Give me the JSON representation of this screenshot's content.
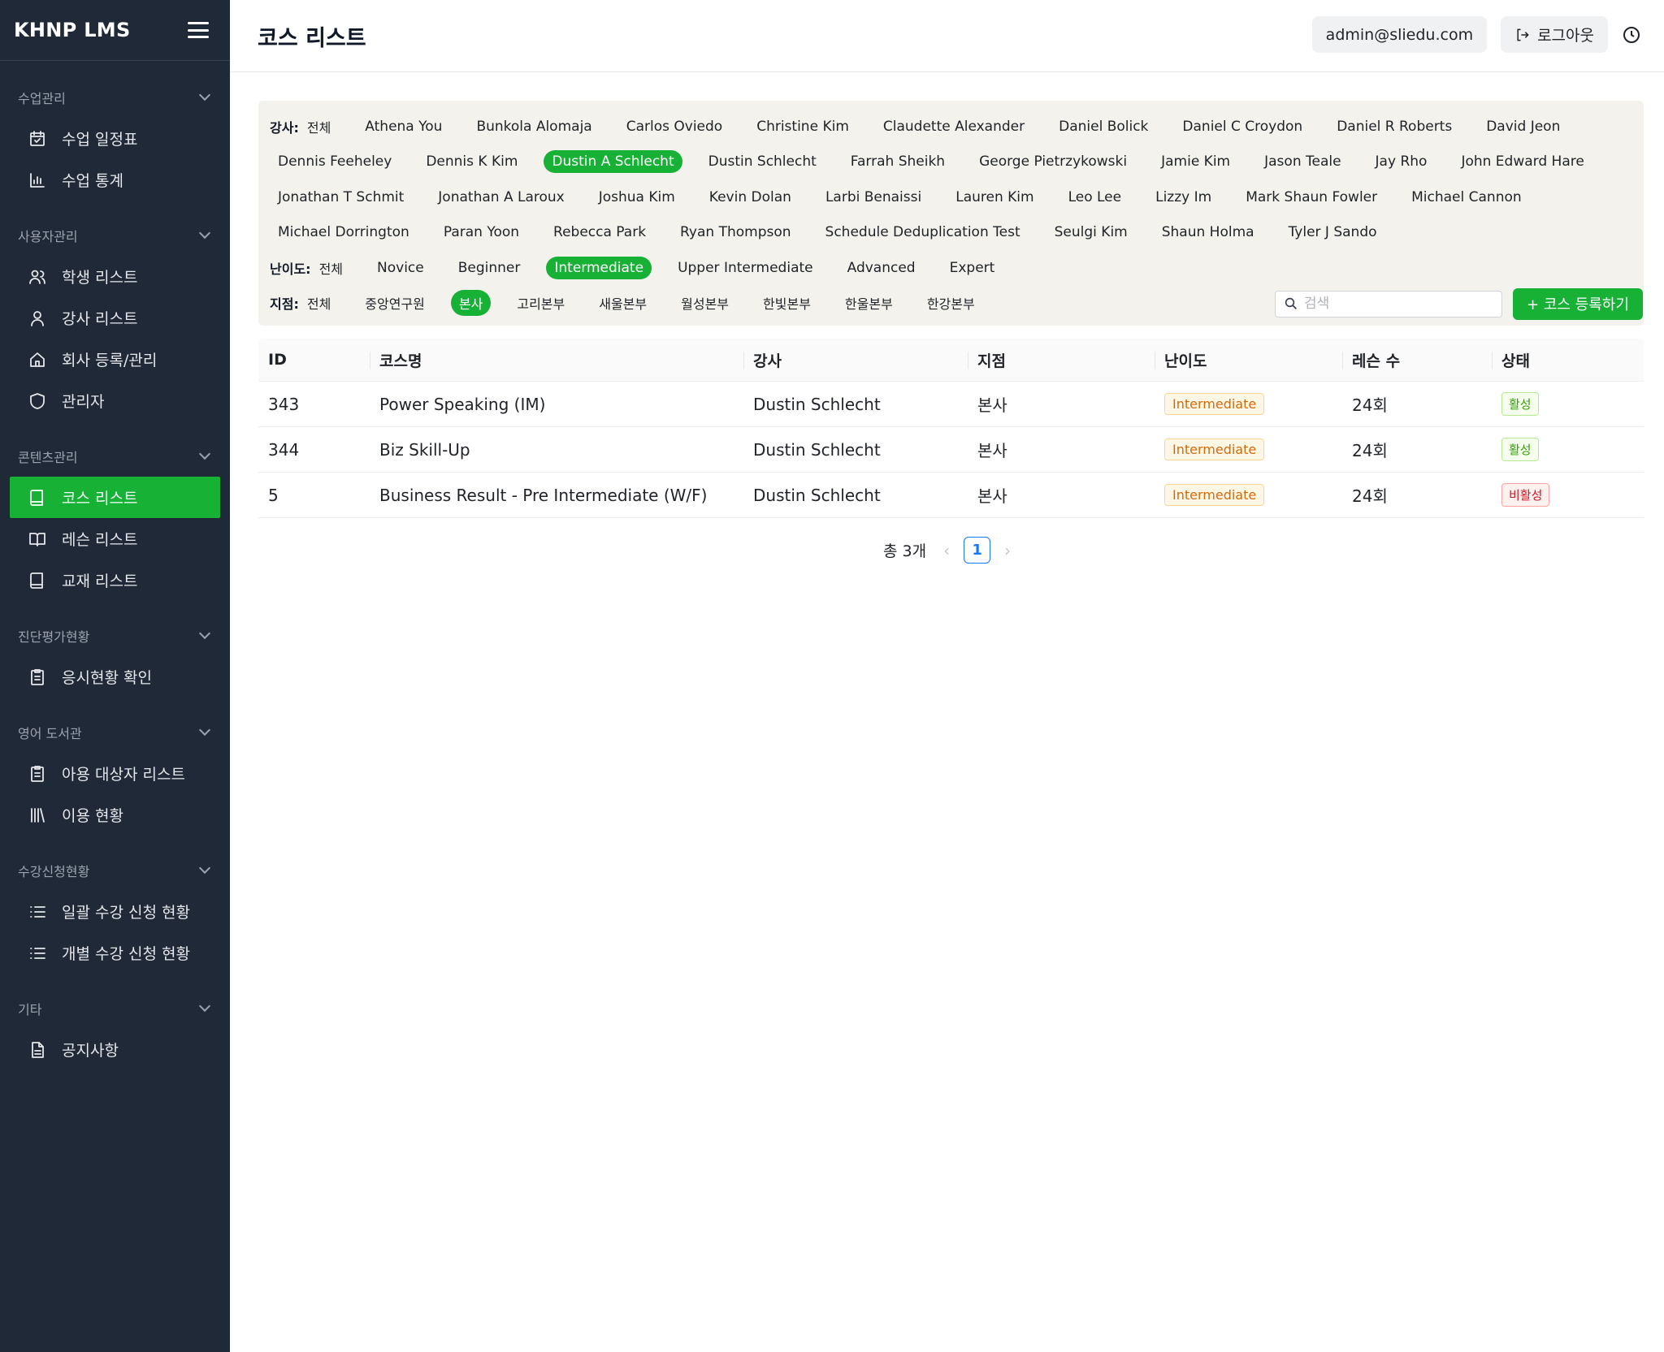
{
  "app": {
    "brand": "KHNP LMS"
  },
  "header": {
    "title": "코스 리스트",
    "email": "admin@sliedu.com",
    "logout_label": "로그아웃"
  },
  "sidebar": {
    "sections": [
      {
        "label": "수업관리",
        "items": [
          {
            "label": "수업 일정표",
            "icon": "calendar-check-icon"
          },
          {
            "label": "수업 통계",
            "icon": "bar-chart-icon"
          }
        ]
      },
      {
        "label": "사용자관리",
        "items": [
          {
            "label": "학생 리스트",
            "icon": "users-icon"
          },
          {
            "label": "강사 리스트",
            "icon": "user-icon"
          },
          {
            "label": "회사 등록/관리",
            "icon": "home-icon"
          },
          {
            "label": "관리자",
            "icon": "shield-icon"
          }
        ]
      },
      {
        "label": "콘텐츠관리",
        "items": [
          {
            "label": "코스 리스트",
            "icon": "book-icon",
            "active": true
          },
          {
            "label": "레슨 리스트",
            "icon": "book-open-icon"
          },
          {
            "label": "교재 리스트",
            "icon": "book-icon"
          }
        ]
      },
      {
        "label": "진단평가현황",
        "items": [
          {
            "label": "응시현황 확인",
            "icon": "clipboard-list-icon"
          }
        ]
      },
      {
        "label": "영어 도서관",
        "items": [
          {
            "label": "아용 대상자 리스트",
            "icon": "clipboard-list-icon"
          },
          {
            "label": "이용 현황",
            "icon": "library-icon"
          }
        ]
      },
      {
        "label": "수강신청현황",
        "items": [
          {
            "label": "일괄 수강 신청 현황",
            "icon": "list-icon"
          },
          {
            "label": "개별 수강 신청 현황",
            "icon": "list-icon"
          }
        ]
      },
      {
        "label": "기타",
        "items": [
          {
            "label": "공지사항",
            "icon": "file-text-icon"
          }
        ]
      }
    ]
  },
  "filters": {
    "instructor_label": "강사:",
    "instructor_rows": [
      [
        "전체",
        "Athena You",
        "Bunkola Alomaja",
        "Carlos Oviedo",
        "Christine Kim",
        "Claudette Alexander",
        "Daniel Bolick",
        "Daniel C Croydon",
        "Daniel R Roberts",
        "David Jeon"
      ],
      [
        "Dennis Feeheley",
        "Dennis K Kim",
        "Dustin A Schlecht",
        "Dustin Schlecht",
        "Farrah Sheikh",
        "George Pietrzykowski",
        "Jamie Kim",
        "Jason Teale",
        "Jay Rho",
        "John Edward Hare"
      ],
      [
        "Jonathan T Schmit",
        "Jonathan A Laroux",
        "Joshua Kim",
        "Kevin Dolan",
        "Larbi Benaissi",
        "Lauren Kim",
        "Leo Lee",
        "Lizzy Im",
        "Mark Shaun Fowler",
        "Michael Cannon"
      ],
      [
        "Michael Dorrington",
        "Paran Yoon",
        "Rebecca Park",
        "Ryan Thompson",
        "Schedule Deduplication Test",
        "Seulgi Kim",
        "Shaun Holma",
        "Tyler J Sando"
      ]
    ],
    "instructor_selected": "Dustin A Schlecht",
    "level_label": "난이도:",
    "levels": [
      "전체",
      "Novice",
      "Beginner",
      "Intermediate",
      "Upper Intermediate",
      "Advanced",
      "Expert"
    ],
    "level_selected": "Intermediate",
    "branch_label": "지점:",
    "branches": [
      "전체",
      "중앙연구원",
      "본사",
      "고리본부",
      "새울본부",
      "월성본부",
      "한빛본부",
      "한울본부",
      "한강본부"
    ],
    "branch_selected": "본사",
    "search_placeholder": "검색",
    "add_button": "+ 코스 등록하기"
  },
  "table": {
    "columns": [
      "ID",
      "코스명",
      "강사",
      "지점",
      "난이도",
      "레슨 수",
      "상태"
    ],
    "rows": [
      {
        "id": "343",
        "name": "Power Speaking (IM)",
        "instructor": "Dustin Schlecht",
        "branch": "본사",
        "level": "Intermediate",
        "lessons": "24회",
        "status": "활성",
        "active": true
      },
      {
        "id": "344",
        "name": "Biz Skill-Up",
        "instructor": "Dustin Schlecht",
        "branch": "본사",
        "level": "Intermediate",
        "lessons": "24회",
        "status": "활성",
        "active": true
      },
      {
        "id": "5",
        "name": "Business Result - Pre Intermediate (W/F)",
        "instructor": "Dustin Schlecht",
        "branch": "본사",
        "level": "Intermediate",
        "lessons": "24회",
        "status": "비활성",
        "active": false
      }
    ]
  },
  "pagination": {
    "total": "총 3개",
    "current": "1"
  },
  "colors": {
    "sidebar_bg": "#1f2937",
    "accent_green": "#16b135",
    "filter_bg": "#f3f2ec",
    "page_blue": "#1677ff"
  }
}
